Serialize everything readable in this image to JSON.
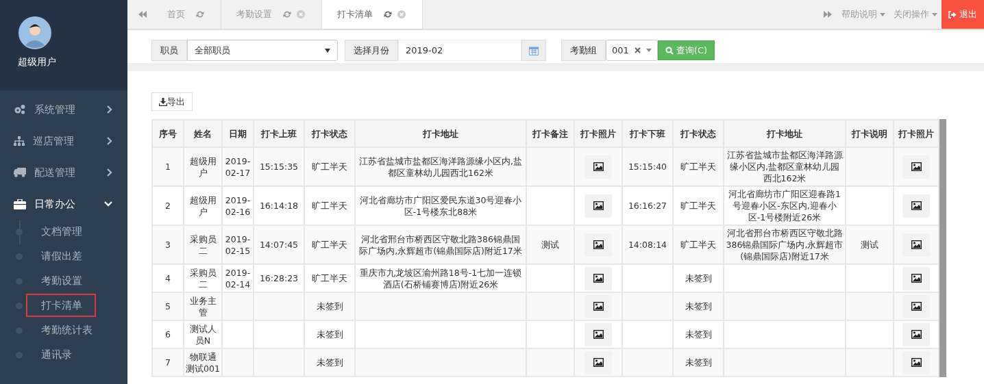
{
  "user": {
    "name": "超级用户"
  },
  "menu": [
    {
      "label": "系统管理",
      "expanded": false
    },
    {
      "label": "巡店管理",
      "expanded": false
    },
    {
      "label": "配送管理",
      "expanded": false
    },
    {
      "label": "日常办公",
      "expanded": true,
      "children": [
        {
          "label": "文档管理",
          "selected": false
        },
        {
          "label": "请假出差",
          "selected": false
        },
        {
          "label": "考勤设置",
          "selected": false
        },
        {
          "label": "打卡清单",
          "selected": true
        },
        {
          "label": "考勤统计表",
          "selected": false
        },
        {
          "label": "通讯录",
          "selected": false
        }
      ]
    }
  ],
  "tabs": [
    {
      "label": "首页",
      "closable": false,
      "selected": false
    },
    {
      "label": "考勤设置",
      "closable": true,
      "selected": false
    },
    {
      "label": "打卡清单",
      "closable": true,
      "selected": true
    }
  ],
  "header_menus": [
    "帮助说明",
    "关闭操作"
  ],
  "logout": "退出",
  "filters": {
    "employee_label": "职员",
    "employee_value": "全部职员",
    "month_label": "选择月份",
    "month_value": "2019-02",
    "group_label": "考勤组",
    "group_value": "001",
    "query_button": "查询(C)"
  },
  "export_button": "导出",
  "table": {
    "columns": [
      "序号",
      "姓名",
      "日期",
      "打卡上班",
      "打卡状态",
      "打卡地址",
      "打卡备注",
      "打卡照片",
      "打卡下班",
      "打卡状态",
      "打卡地址",
      "打卡说明",
      "打卡照片"
    ],
    "rows": [
      {
        "no": "1",
        "name": "超级用户",
        "date": "2019-02-17",
        "in_time": "15:15:35",
        "in_status": "旷工半天",
        "in_address": "江苏省盐城市盐都区海洋路源缘小区内,盐都区童林幼儿园西北162米",
        "in_note": "",
        "out_time": "15:15:40",
        "out_status": "旷工半天",
        "out_address": "江苏省盐城市盐都区海洋路源缘小区内,盐都区童林幼儿园西北162米",
        "out_note": ""
      },
      {
        "no": "2",
        "name": "超级用户",
        "date": "2019-02-16",
        "in_time": "16:14:18",
        "in_status": "旷工半天",
        "in_address": "河北省廊坊市广阳区爱民东道30号迎春小区-1号楼东北88米",
        "in_note": "",
        "out_time": "16:16:27",
        "out_status": "旷工半天",
        "out_address": "河北省廊坊市广阳区迎春路1号迎春小区-东区内,迎春小区-1号楼附近26米",
        "out_note": ""
      },
      {
        "no": "3",
        "name": "采购员二",
        "date": "2019-02-15",
        "in_time": "14:07:45",
        "in_status": "旷工半天",
        "in_address": "河北省邢台市桥西区守敬北路386锦鼎国际广场内,永辉超市(锦鼎国际店)附近17米",
        "in_note": "测试",
        "out_time": "14:08:14",
        "out_status": "旷工半天",
        "out_address": "河北省邢台市桥西区守敬北路386锦鼎国际广场内,永辉超市(锦鼎国际店)附近17米",
        "out_note": "测试"
      },
      {
        "no": "4",
        "name": "采购员二",
        "date": "2019-02-14",
        "in_time": "16:28:23",
        "in_status": "旷工半天",
        "in_address": "重庆市九龙坡区渝州路18号-1七加一连锁酒店(石桥铺赛博店)附近26米",
        "in_note": "",
        "out_time": "",
        "out_status": "未签到",
        "out_address": "",
        "out_note": ""
      },
      {
        "no": "5",
        "name": "业务主管",
        "date": "",
        "in_time": "",
        "in_status": "未签到",
        "in_address": "",
        "in_note": "",
        "out_time": "",
        "out_status": "未签到",
        "out_address": "",
        "out_note": ""
      },
      {
        "no": "6",
        "name": "测试人员N",
        "date": "",
        "in_time": "",
        "in_status": "未签到",
        "in_address": "",
        "in_note": "",
        "out_time": "",
        "out_status": "未签到",
        "out_address": "",
        "out_note": ""
      },
      {
        "no": "7",
        "name": "物联通测试001",
        "date": "",
        "in_time": "",
        "in_status": "未签到",
        "in_address": "",
        "in_note": "",
        "out_time": "",
        "out_status": "未签到",
        "out_address": "",
        "out_note": ""
      }
    ]
  }
}
